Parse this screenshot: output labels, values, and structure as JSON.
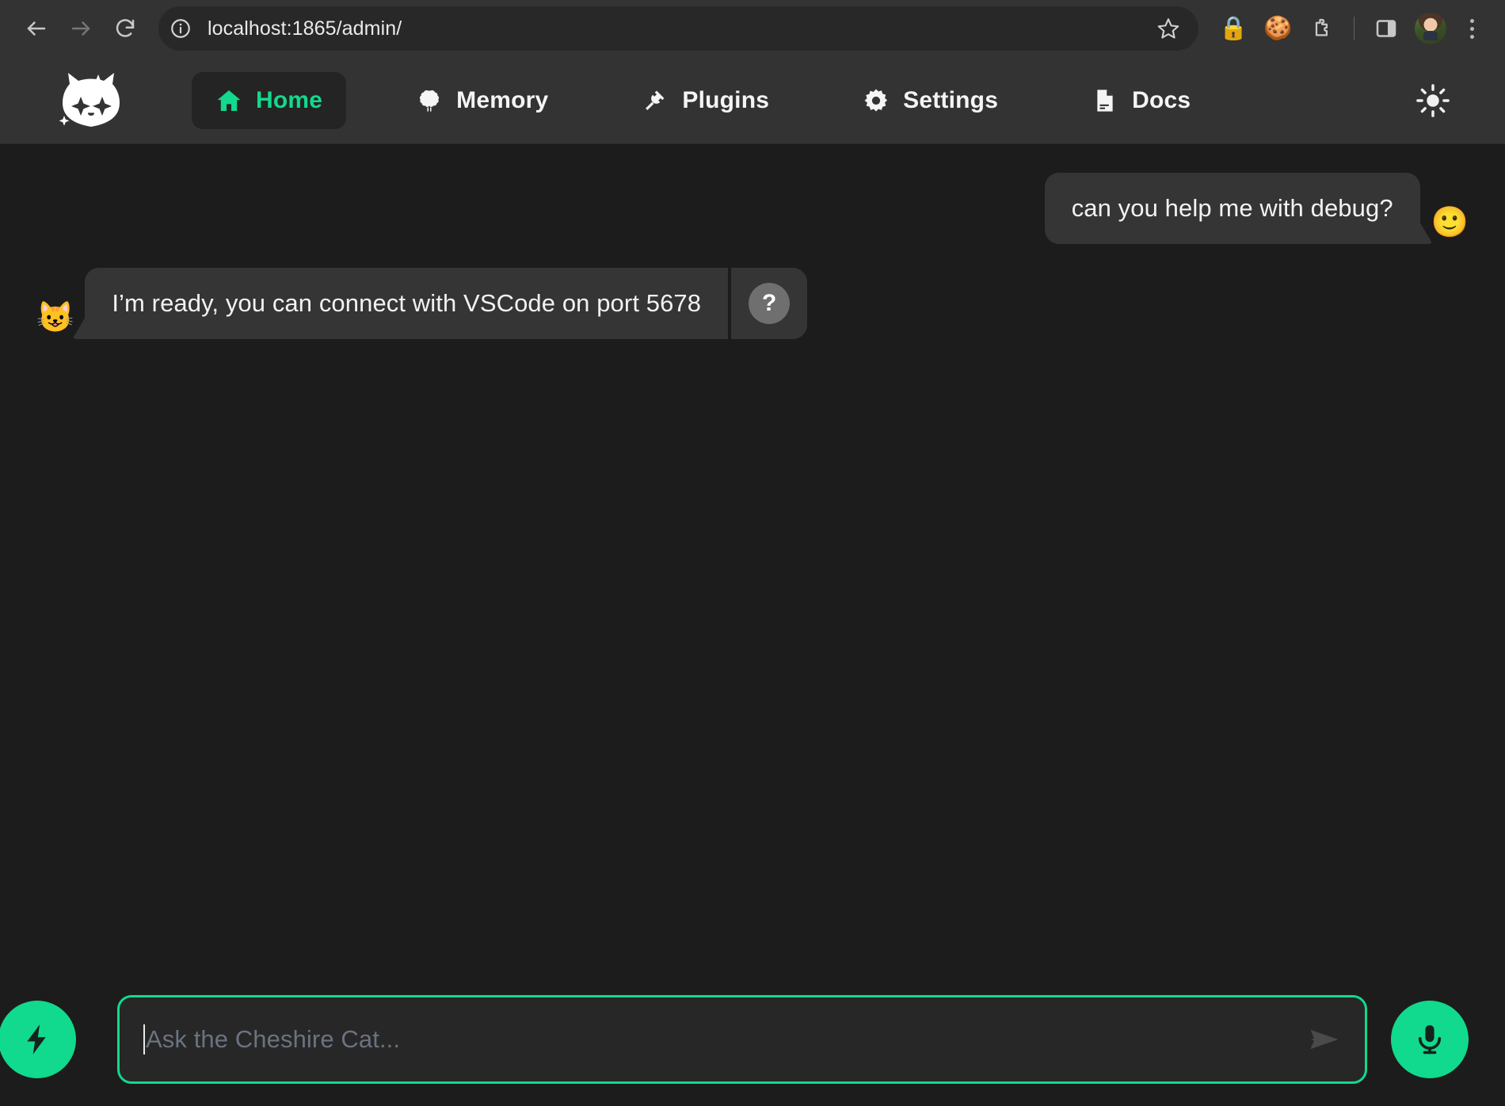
{
  "browser": {
    "back_label": "Back",
    "forward_label": "Forward",
    "reload_label": "Reload",
    "site_info_label": "View site information",
    "url": "localhost:1865/admin/",
    "bookmark_label": "Bookmark this tab",
    "extensions": [
      {
        "name": "lock-icon",
        "glyph": "🔒"
      },
      {
        "name": "cookie-icon",
        "glyph": "🍪"
      }
    ],
    "puzzle_label": "Extensions",
    "side_panel_label": "Side panel",
    "profile_label": "Profile",
    "menu_label": "Customize and control"
  },
  "app": {
    "logo_name": "cheshire-cat-logo",
    "nav": [
      {
        "id": "home",
        "label": "Home",
        "icon": "home-icon",
        "active": true
      },
      {
        "id": "memory",
        "label": "Memory",
        "icon": "brain-icon",
        "active": false
      },
      {
        "id": "plugins",
        "label": "Plugins",
        "icon": "plug-icon",
        "active": false
      },
      {
        "id": "settings",
        "label": "Settings",
        "icon": "gear-icon",
        "active": false
      },
      {
        "id": "docs",
        "label": "Docs",
        "icon": "document-icon",
        "active": false
      }
    ],
    "theme_toggle": {
      "icon": "sun-icon",
      "label": "Toggle theme"
    }
  },
  "chat": {
    "messages": [
      {
        "role": "user",
        "avatar": "🙂",
        "text": "can you help me with debug?"
      },
      {
        "role": "bot",
        "avatar": "😺",
        "text": "I’m ready, you can connect with VSCode on port 5678",
        "why_label": "?"
      }
    ]
  },
  "composer": {
    "lightning_label": "Quick actions",
    "placeholder": "Ask the Cheshire Cat...",
    "value": "",
    "send_label": "Send",
    "mic_label": "Record audio"
  },
  "colors": {
    "accent": "#12d98d",
    "chrome_bg": "#333333",
    "app_bg": "#1c1c1c",
    "bubble_bg": "#353535",
    "placeholder": "#6b7280"
  }
}
